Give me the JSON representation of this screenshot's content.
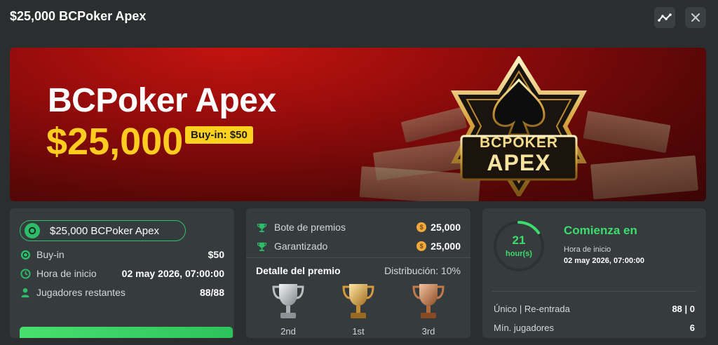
{
  "header": {
    "title": "$25,000 BCPoker Apex",
    "chart_icon": "activity-chart-icon",
    "close_icon": "close-icon"
  },
  "banner": {
    "name": "BCPoker Apex",
    "amount": "$25,000",
    "buyin_tag": "Buy-in: $50",
    "logo_line1": "BCPOKER",
    "logo_line2": "APEX"
  },
  "info_panel": {
    "tourney_name": "$25,000 BCPoker Apex",
    "rows": [
      {
        "label": "Buy-in",
        "value": "$50",
        "icon": "coin-icon"
      },
      {
        "label": "Hora de inicio",
        "value": "02 may 2026, 07:00:00",
        "icon": "clock-icon"
      },
      {
        "label": "Jugadores restantes",
        "value": "88/88",
        "icon": "user-icon"
      }
    ]
  },
  "prize_panel": {
    "bote_label": "Bote de premios",
    "bote_value": "25,000",
    "garantizado_label": "Garantizado",
    "garantizado_value": "25,000",
    "detalle_label": "Detalle del premio",
    "distribucion_label": "Distribución: 10%",
    "places": [
      "2nd",
      "1st",
      "3rd"
    ]
  },
  "start_panel": {
    "timer_value": "21",
    "timer_unit": "hour(s)",
    "comienza": "Comienza en",
    "hora_label": "Hora de inicio",
    "hora_value": "02 may 2026, 07:00:00",
    "rows": [
      {
        "label": "Único | Re-entrada",
        "value": "88 | 0"
      },
      {
        "label": "Mín. jugadores",
        "value": "6"
      }
    ]
  },
  "colors": {
    "accent_green": "#3ddc6e",
    "banner_red": "#8f0b0b",
    "gold": "#ffcc1f",
    "panel_bg": "#363c3d"
  }
}
